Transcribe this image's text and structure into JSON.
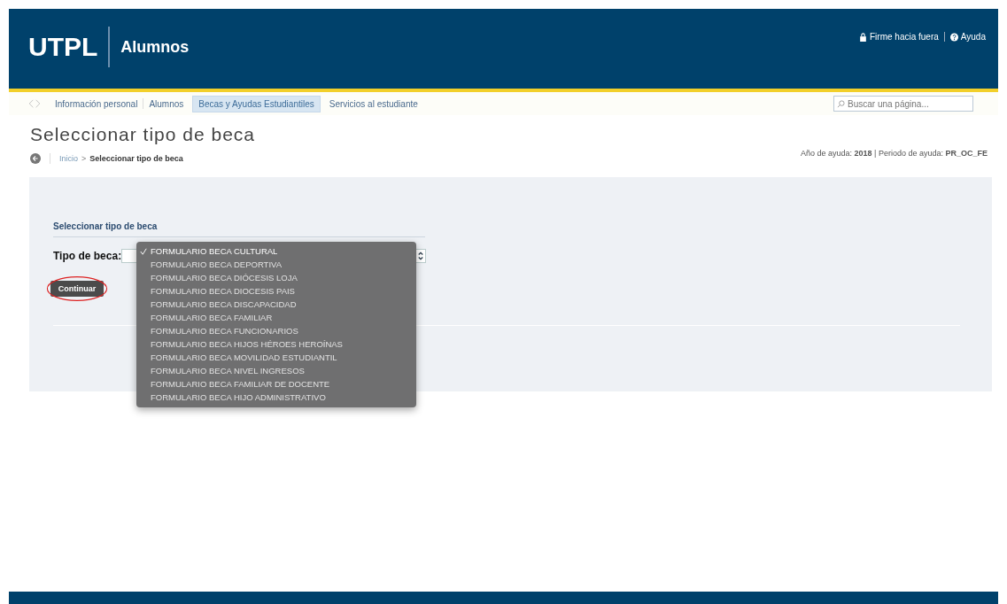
{
  "header": {
    "logo": "UTPL",
    "app_name": "Alumnos",
    "links": [
      {
        "kind": "logout",
        "label": "Firme hacia fuera"
      },
      {
        "kind": "help",
        "label": "Ayuda"
      }
    ]
  },
  "nav": {
    "tabs": [
      {
        "label": "Información personal",
        "selected": false
      },
      {
        "label": "Alumnos",
        "selected": false
      },
      {
        "label": "Becas y Ayudas Estudiantiles",
        "selected": true
      },
      {
        "label": "Servicios al estudiante",
        "selected": false
      }
    ],
    "search": {
      "placeholder": "Buscar una página..."
    }
  },
  "page_title": "Seleccionar tipo de beca",
  "info": {
    "year_label": "Año de ayuda:",
    "year": "2018",
    "separator": "|",
    "period_label": "Periodo de ayuda:",
    "period": "PR_OC_FE"
  },
  "breadcrumb": [
    "Inicio",
    "Seleccionar tipo de beca"
  ],
  "breadcrumb_separator": ">",
  "form": {
    "section_title": "Seleccionar tipo de beca",
    "field_label": "Tipo de beca:",
    "button": "Continuar",
    "button_highlighted": true,
    "options": [
      {
        "label": "FORMULARIO BECA CULTURAL",
        "selected": true
      },
      {
        "label": "FORMULARIO BECA DEPORTIVA",
        "selected": false
      },
      {
        "label": "FORMULARIO BECA DIÓCESIS LOJA",
        "selected": false
      },
      {
        "label": "FORMULARIO BECA DIOCESIS PAIS",
        "selected": false
      },
      {
        "label": "FORMULARIO BECA DISCAPACIDAD",
        "selected": false
      },
      {
        "label": "FORMULARIO BECA FAMILIAR",
        "selected": false
      },
      {
        "label": "FORMULARIO BECA FUNCIONARIOS",
        "selected": false
      },
      {
        "label": "FORMULARIO BECA HIJOS HÉROES HEROÍNAS",
        "selected": false
      },
      {
        "label": "FORMULARIO BECA MOVILIDAD ESTUDIANTIL",
        "selected": false
      },
      {
        "label": "FORMULARIO BECA NIVEL INGRESOS",
        "selected": false
      },
      {
        "label": "FORMULARIO BECA FAMILIAR DE DOCENTE",
        "selected": false
      },
      {
        "label": "FORMULARIO BECA HIJO ADMINISTRATIVO",
        "selected": false
      }
    ]
  }
}
